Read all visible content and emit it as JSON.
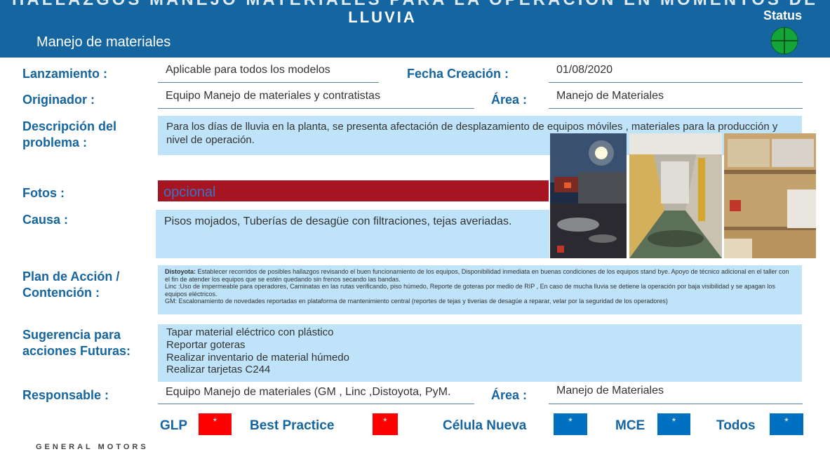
{
  "header": {
    "cut_title": "HALLAZGOS MANEJO MATERIALES PARA LA OPERACIÓN EN MOMENTOS DE",
    "title": "LLUVIA",
    "subtitle": "Manejo de materiales",
    "status_label": "Status",
    "status_color": "#13a538"
  },
  "fields": {
    "lanzamiento_label": "Lanzamiento :",
    "lanzamiento_value": "Aplicable para todos los modelos",
    "fecha_label": "Fecha Creación :",
    "fecha_value": "01/08/2020",
    "originador_label": "Originador :",
    "originador_value": "Equipo Manejo de materiales y contratistas",
    "area_label": "Área :",
    "area_value": "Manejo de Materiales",
    "descripcion_label": "Descripción del problema :",
    "descripcion_value": "Para los días de lluvia en la planta, se presenta afectación de desplazamiento de equipos móviles , materiales para la producción y nivel de operación.",
    "fotos_label": "Fotos :",
    "fotos_value": "opcional",
    "causa_label": "Causa :",
    "causa_value": "Pisos mojados, Tuberías de desagüe con filtraciones, tejas averiadas.",
    "plan_label": "Plan de Acción / Contención :",
    "plan_distoyota_label": "Distoyota:",
    "plan_distoyota": " Establecer recorridos de posibles hallazgos revisando el buen funcionamiento de los equipos, Disponibilidad inmediata en buenas condiciones de los equipos stand bye. Apoyo de técnico adicional en el taller con el fin de atender los equipos que se estén quedando sin frenos secando las bandas.",
    "plan_linc": "Linc :Uso de impermeable para operadores, Caminatas en las rutas verificando, piso húmedo, Reporte de goteras por medio de RIP , En caso de mucha lluvia se detiene la operación por baja visibilidad y se apagan los equipos eléctricos.",
    "plan_gm": "GM: Escalonamiento de novedades reportadas en plataforma de mantenimiento central (reportes de tejas y tiverias de desagüe a reparar, velar por la seguridad de los operadores)",
    "sugerencia_label": "Sugerencia para acciones  Futuras:",
    "sugerencias": [
      "Tapar material eléctrico con plástico",
      "Reportar goteras",
      "Realizar inventario de material húmedo",
      "Realizar tarjetas C244"
    ],
    "responsable_label": "Responsable :",
    "responsable_value": "Equipo Manejo de materiales (GM , Linc ,Distoyota, PyM.",
    "area2_label": "Área :",
    "area2_value": "Manejo de Materiales"
  },
  "flags": {
    "glp": "GLP",
    "glp_mark": "*",
    "glp_color": "#ff0000",
    "best": "Best Practice",
    "best_mark": "*",
    "best_color": "#ff0000",
    "celula": "Célula Nueva",
    "celula_mark": "*",
    "celula_color": "#0070c0",
    "mce": "MCE",
    "mce_mark": "*",
    "mce_color": "#0070c0",
    "todos": "Todos",
    "todos_mark": "*",
    "todos_color": "#0070c0"
  },
  "footer": {
    "logo": "GENERAL MOTORS"
  }
}
